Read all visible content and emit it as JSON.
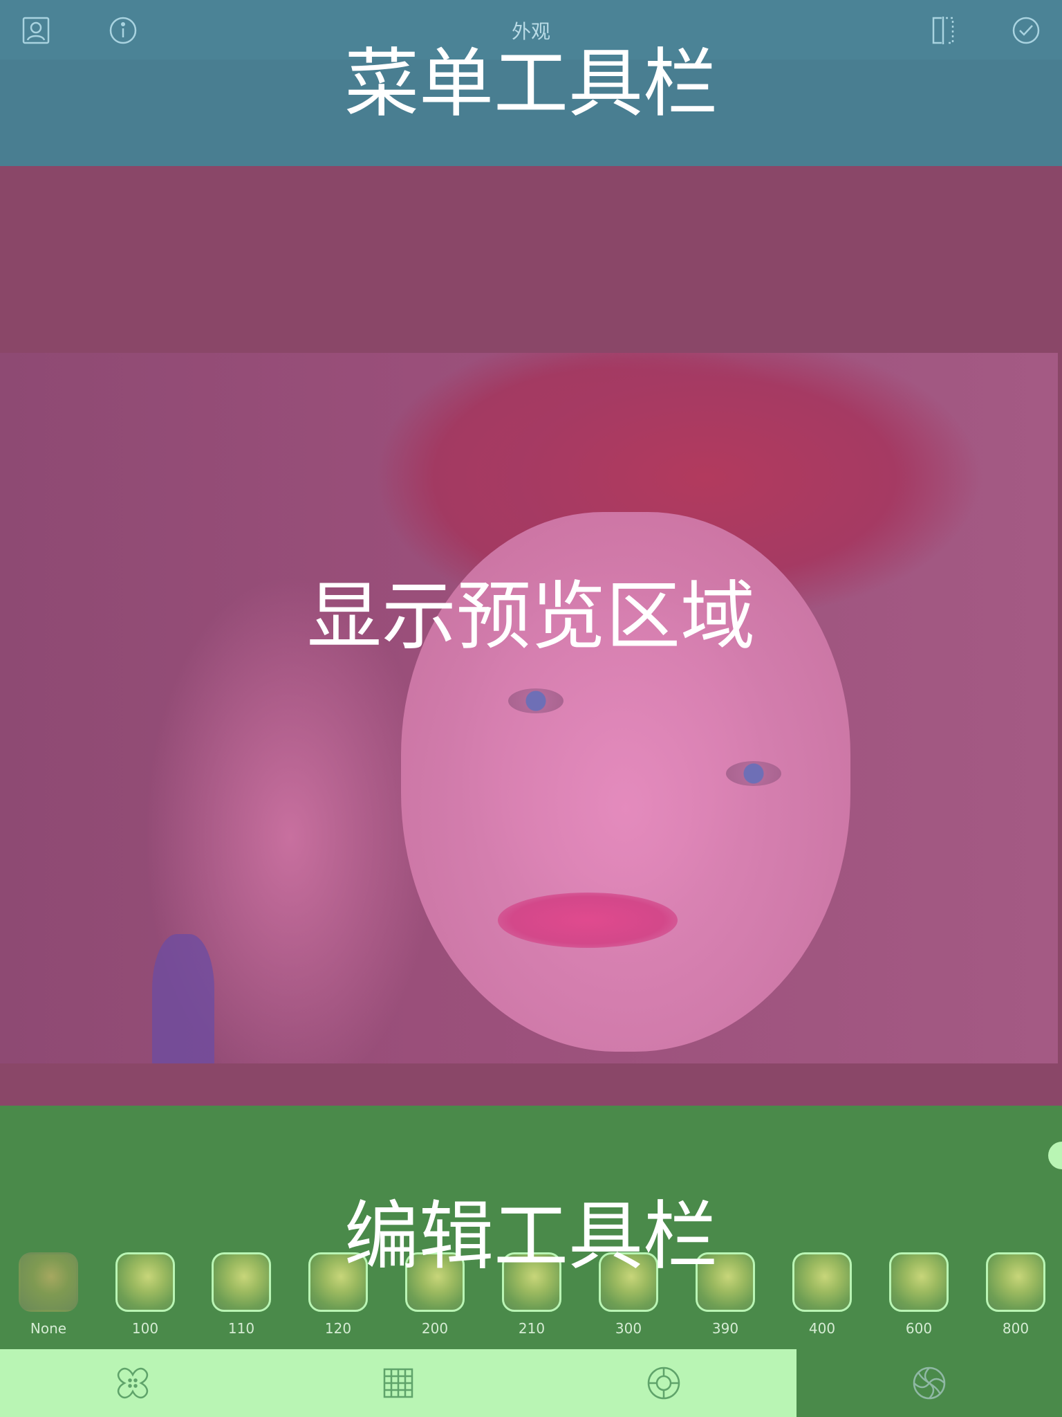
{
  "header": {
    "title": "外观",
    "icons": [
      "portrait-icon",
      "info-icon",
      "compare-icon",
      "confirm-check-icon"
    ]
  },
  "overlays": {
    "menu_toolbar": "菜单工具栏",
    "preview_area": "显示预览区域",
    "edit_toolbar": "编辑工具栏"
  },
  "filters": {
    "selected": "None",
    "items": [
      {
        "label": "None"
      },
      {
        "label": "100"
      },
      {
        "label": "110"
      },
      {
        "label": "120"
      },
      {
        "label": "200"
      },
      {
        "label": "210"
      },
      {
        "label": "300"
      },
      {
        "label": "390"
      },
      {
        "label": "400"
      },
      {
        "label": "600"
      },
      {
        "label": "800"
      }
    ]
  },
  "tabs": [
    {
      "name": "healing-icon",
      "active": false
    },
    {
      "name": "grid-icon",
      "active": false
    },
    {
      "name": "aperture-icon",
      "active": false
    },
    {
      "name": "swirl-icon",
      "active": true
    }
  ],
  "colors": {
    "menu_region": "#497e91",
    "preview_region": "#8a4768",
    "edit_region": "#4a8a4a",
    "tabbar": "#b9f5b4"
  }
}
